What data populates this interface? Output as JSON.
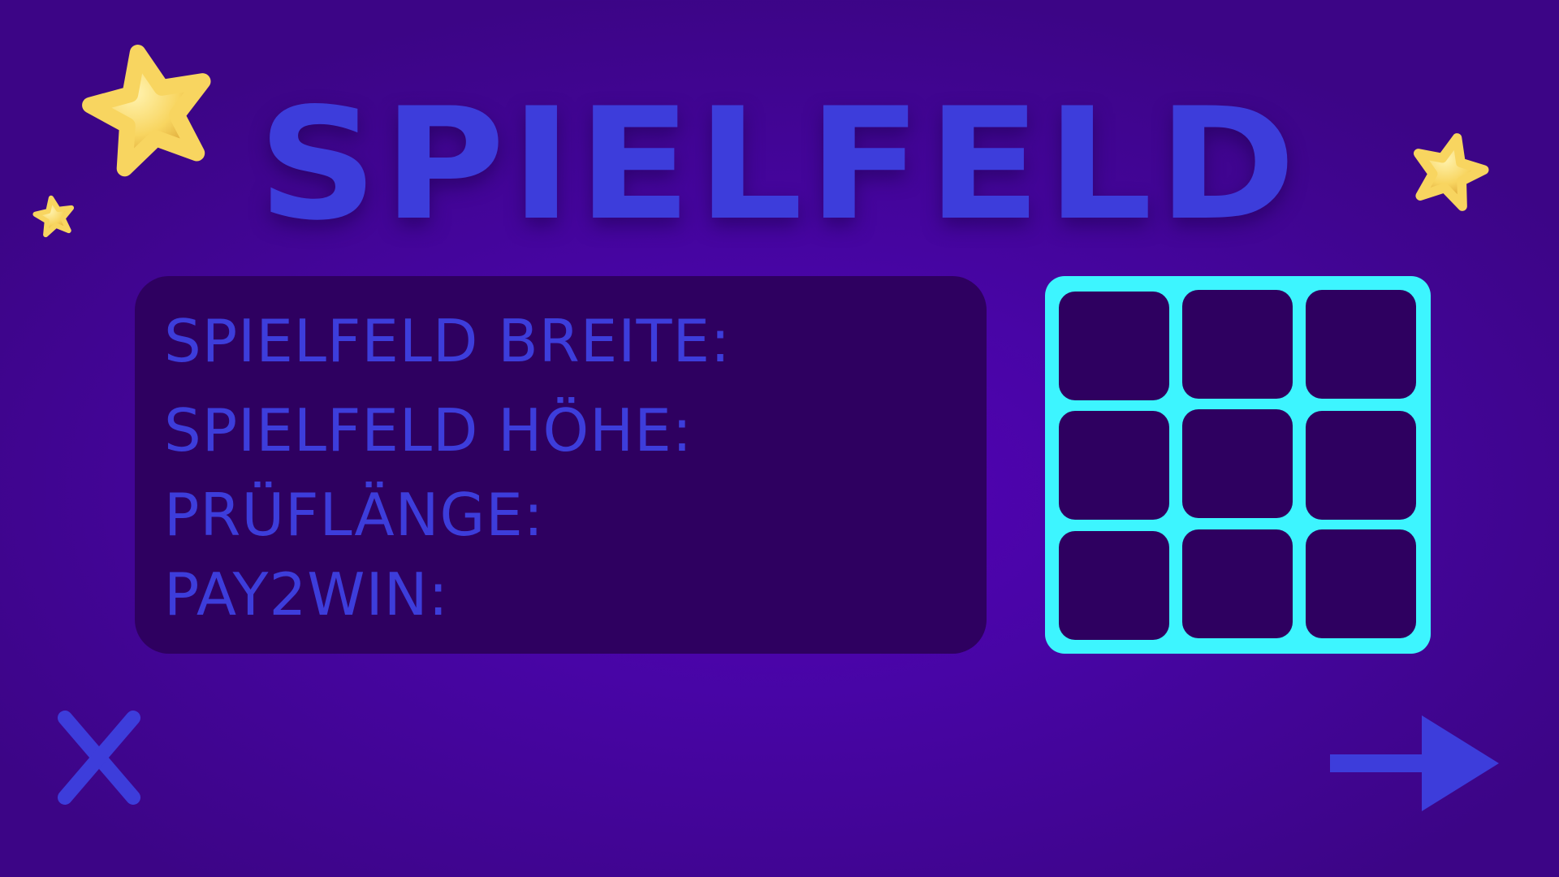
{
  "title": "SPIELFELD",
  "settings": [
    {
      "label": "SPIELFELD BREITE:"
    },
    {
      "label": "SPIELFELD HÖHE:"
    },
    {
      "label": "PRÜFLÄNGE:"
    },
    {
      "label": "PAY2WIN:"
    }
  ],
  "grid_preview": {
    "rows": 3,
    "cols": 3
  },
  "colors": {
    "background": "#4805a6",
    "accent": "#3d3ddb",
    "panel": "#2e0060",
    "grid_border": "#3df5ff",
    "star": "#f8d560"
  },
  "icons": {
    "cancel": "close-icon",
    "continue": "arrow-right-icon",
    "decoration": "star-icon"
  }
}
